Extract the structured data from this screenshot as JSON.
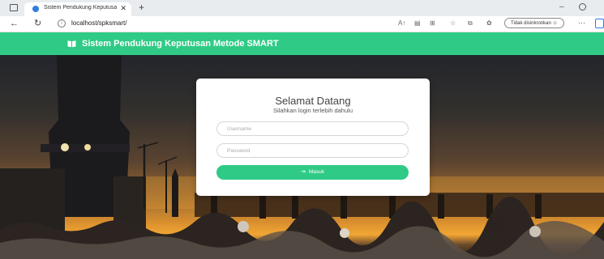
{
  "browser": {
    "tab_title": "Sistem Pendukung Keputusan M",
    "url": "localhost/spksmart/",
    "sync_label": "Tidak disinkronkan"
  },
  "app": {
    "title": "Sistem Pendukung Keputusan Metode SMART",
    "accent_color": "#2fcb86"
  },
  "login": {
    "heading": "Selamat Datang",
    "subheading": "Silahkan login terlebih dahulu",
    "username_placeholder": "Username",
    "password_placeholder": "Password",
    "submit_label": "Masuk"
  },
  "icons": {
    "window_menu": "window-icon",
    "back": "back-arrow-icon",
    "reload": "reload-icon",
    "info": "info-icon",
    "login_button": "login-arrow-icon",
    "header": "book-icon"
  }
}
